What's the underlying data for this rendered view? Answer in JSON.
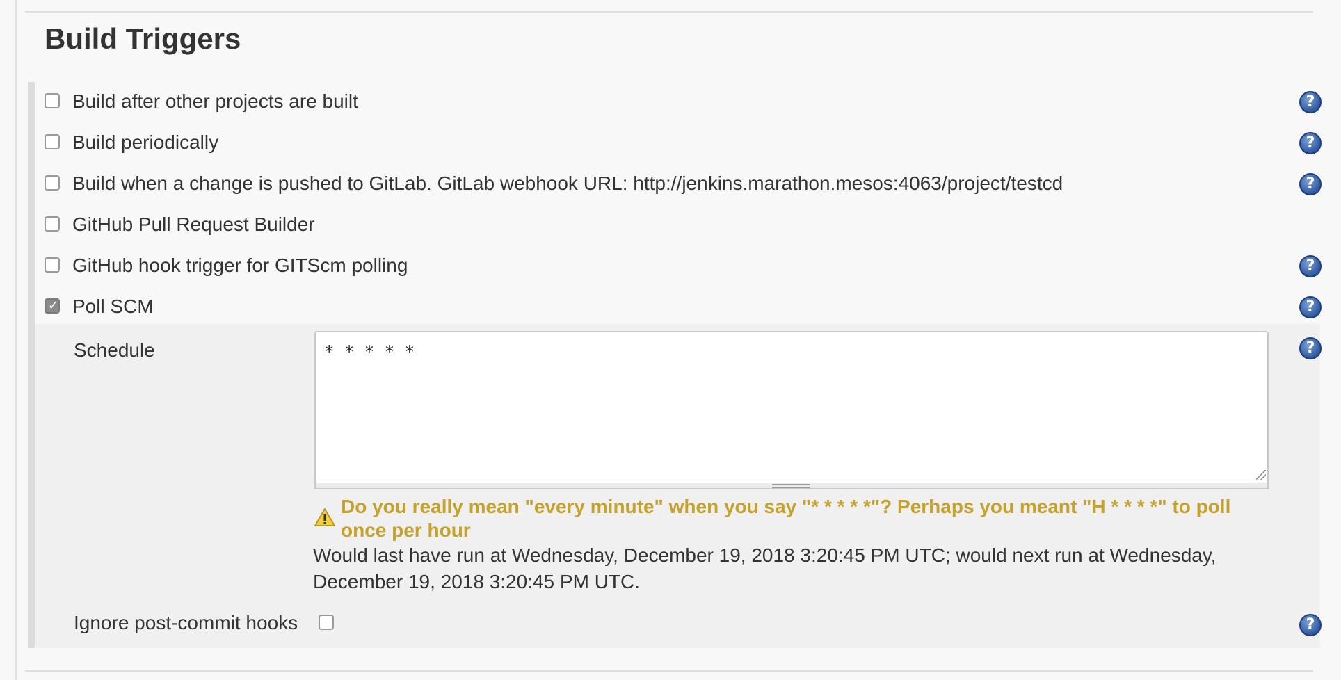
{
  "section": {
    "title": "Build Triggers"
  },
  "triggers": [
    {
      "label": "Build after other projects are built",
      "checked": false,
      "help": true
    },
    {
      "label": "Build periodically",
      "checked": false,
      "help": true
    },
    {
      "label": "Build when a change is pushed to GitLab. GitLab webhook URL: http://jenkins.marathon.mesos:4063/project/testcd",
      "checked": false,
      "help": true
    },
    {
      "label": "GitHub Pull Request Builder",
      "checked": false,
      "help": false
    },
    {
      "label": "GitHub hook trigger for GITScm polling",
      "checked": false,
      "help": true
    },
    {
      "label": "Poll SCM",
      "checked": true,
      "help": true
    }
  ],
  "poll_scm": {
    "schedule_label": "Schedule",
    "schedule_value": "* * * * *",
    "warning": "Do you really mean \"every minute\" when you say \"* * * * *\"? Perhaps you meant \"H * * * *\" to poll once per hour",
    "info": "Would last have run at Wednesday, December 19, 2018 3:20:45 PM UTC; would next run at Wednesday, December 19, 2018 3:20:45 PM UTC.",
    "ignore_label": "Ignore post-commit hooks",
    "ignore_checked": false
  },
  "icons": {
    "help": "help-icon",
    "warning": "warning-icon",
    "check": "checkmark-icon"
  },
  "colors": {
    "warning_text": "#c4a22c",
    "help_icon": "#2f5aa0",
    "panel_bg": "#f0f0f0"
  }
}
